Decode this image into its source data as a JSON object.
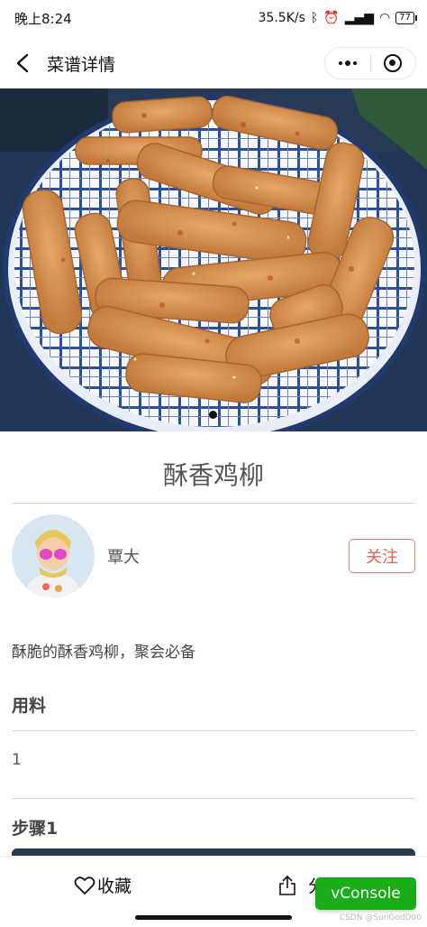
{
  "status_bar": {
    "time": "晚上8:24",
    "network_speed": "35.5K/s",
    "battery": "77",
    "icons": [
      "bluetooth-icon",
      "alarm-icon",
      "hd-icon",
      "signal-icon",
      "wifi-icon",
      "battery-icon"
    ]
  },
  "nav": {
    "title": "菜谱详情",
    "back_icon": "chevron-left-icon",
    "menu_icon": "more-dots-icon",
    "close_icon": "target-close-icon"
  },
  "recipe": {
    "title": "酥香鸡柳",
    "author": "覃大",
    "follow_label": "关注",
    "description": "酥脆的酥香鸡柳，聚会必备",
    "ingredients_heading": "用料",
    "ingredients": [
      "1"
    ],
    "step_heading": "步骤1"
  },
  "bottom_bar": {
    "favorite_label": "收藏",
    "share_label": "分享"
  },
  "vconsole_label": "vConsole",
  "watermark": "CSDN @SunGodD00",
  "colors": {
    "follow_accent": "#e0605a",
    "vconsole_green": "#1aad19"
  }
}
